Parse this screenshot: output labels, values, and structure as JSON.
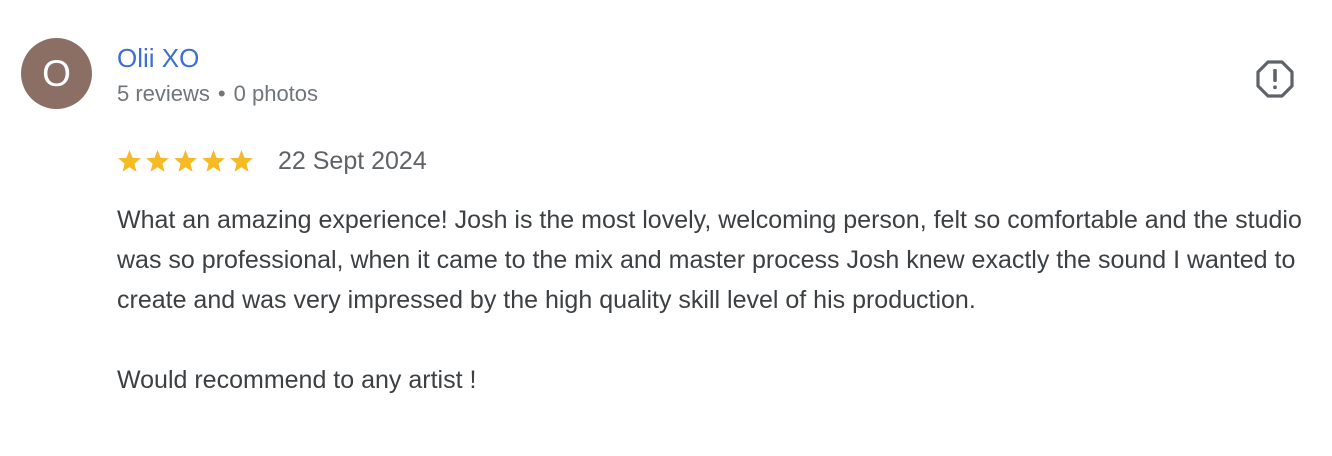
{
  "reviewer": {
    "avatar_initial": "O",
    "avatar_color": "#8b6f65",
    "name": "Olii XO",
    "reviews_count": "5 reviews",
    "separator": "•",
    "photos_count": "0 photos"
  },
  "actions": {
    "flag_icon": "report-flag-icon"
  },
  "rating": {
    "stars": 5,
    "max_stars": 5,
    "star_color": "#f6bb24",
    "date": "22 Sept 2024"
  },
  "review": {
    "paragraph_1": "What an amazing experience! Josh is the most lovely, welcoming person, felt so comfortable and the studio was so professional, when it came to the mix and master process Josh knew exactly the sound I wanted to create and was very impressed by the high quality skill level of his production.",
    "paragraph_2": "Would recommend to any artist !"
  },
  "colors": {
    "name_link": "#3b6fd4",
    "meta_text": "#70757a",
    "body_text": "#3c4043"
  }
}
